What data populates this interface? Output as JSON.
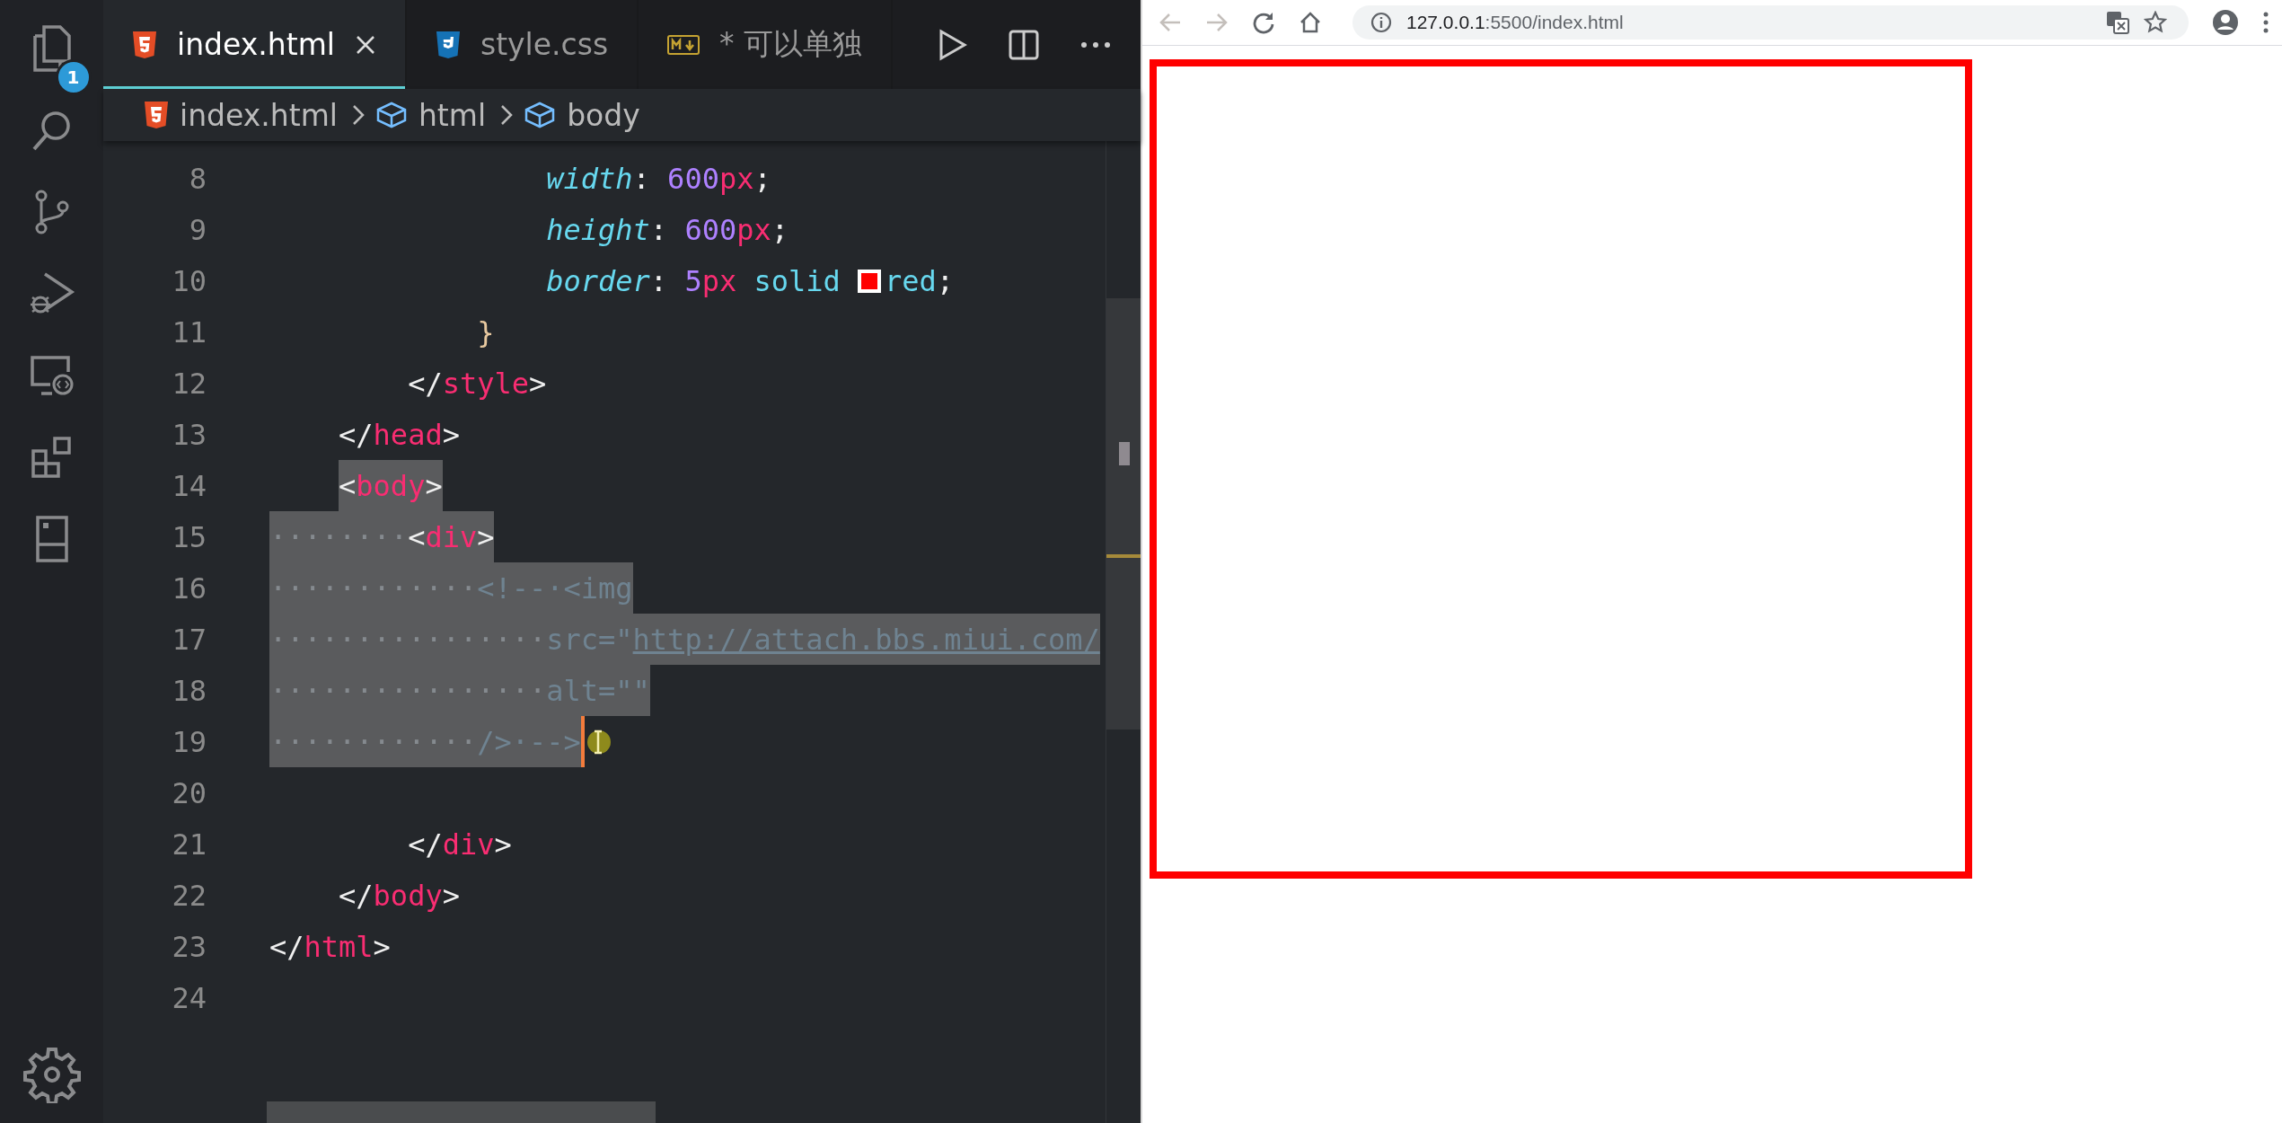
{
  "activity_bar": {
    "explorer_badge": "1"
  },
  "tabs": [
    {
      "label": "index.html",
      "kind": "html",
      "selected": true,
      "closable": true
    },
    {
      "label": "style.css",
      "kind": "css",
      "selected": false,
      "closable": false
    },
    {
      "label": "* 可以单独",
      "kind": "md",
      "selected": false,
      "closable": false
    }
  ],
  "breadcrumb": [
    {
      "label": "index.html",
      "kind": "html"
    },
    {
      "label": "html",
      "kind": "element"
    },
    {
      "label": "body",
      "kind": "element"
    }
  ],
  "code_lines": [
    {
      "number": "8",
      "selected": false,
      "segments": [
        {
          "text": "                width",
          "kind": "prop"
        },
        {
          "text": ": ",
          "kind": "punct"
        },
        {
          "text": "600",
          "kind": "num"
        },
        {
          "text": "px",
          "kind": "unit"
        },
        {
          "text": ";",
          "kind": "punct"
        }
      ]
    },
    {
      "number": "9",
      "selected": false,
      "segments": [
        {
          "text": "                height",
          "kind": "prop"
        },
        {
          "text": ": ",
          "kind": "punct"
        },
        {
          "text": "600",
          "kind": "num"
        },
        {
          "text": "px",
          "kind": "unit"
        },
        {
          "text": ";",
          "kind": "punct"
        }
      ]
    },
    {
      "number": "10",
      "selected": false,
      "segments": [
        {
          "text": "                border",
          "kind": "prop"
        },
        {
          "text": ": ",
          "kind": "punct"
        },
        {
          "text": "5",
          "kind": "num"
        },
        {
          "text": "px",
          "kind": "unit"
        },
        {
          "text": " solid ",
          "kind": "value"
        },
        {
          "kind": "swatch",
          "color": "#ff0000"
        },
        {
          "text": "red",
          "kind": "value"
        },
        {
          "text": ";",
          "kind": "punct"
        }
      ]
    },
    {
      "number": "11",
      "selected": false,
      "segments": [
        {
          "text": "            }",
          "kind": "brace"
        }
      ]
    },
    {
      "number": "12",
      "selected": false,
      "segments": [
        {
          "text": "        </",
          "kind": "punct"
        },
        {
          "text": "style",
          "kind": "tag"
        },
        {
          "text": ">",
          "kind": "punct"
        }
      ]
    },
    {
      "number": "13",
      "selected": false,
      "segments": [
        {
          "text": "    </",
          "kind": "punct"
        },
        {
          "text": "head",
          "kind": "tag"
        },
        {
          "text": ">",
          "kind": "punct"
        }
      ]
    },
    {
      "number": "14",
      "selected": true,
      "segments": [
        {
          "text": "    <",
          "kind": "punct"
        },
        {
          "text": "body",
          "kind": "tag"
        },
        {
          "text": ">",
          "kind": "punct"
        }
      ]
    },
    {
      "number": "15",
      "selected": true,
      "segments": [
        {
          "text": "········",
          "kind": "ws"
        },
        {
          "text": "<",
          "kind": "punct"
        },
        {
          "text": "div",
          "kind": "tag"
        },
        {
          "text": ">",
          "kind": "punct"
        }
      ]
    },
    {
      "number": "16",
      "selected": true,
      "segments": [
        {
          "text": "············",
          "kind": "ws"
        },
        {
          "text": "<!--·<img",
          "kind": "comment"
        }
      ]
    },
    {
      "number": "17",
      "selected": true,
      "segments": [
        {
          "text": "················",
          "kind": "ws"
        },
        {
          "text": "src=\"",
          "kind": "comment"
        },
        {
          "text": "http://attach.bbs.miui.com/",
          "kind": "link"
        }
      ]
    },
    {
      "number": "18",
      "selected": true,
      "segments": [
        {
          "text": "················",
          "kind": "ws"
        },
        {
          "text": "alt=\"\"",
          "kind": "comment"
        }
      ]
    },
    {
      "number": "19",
      "selected": true,
      "segments": [
        {
          "text": "············",
          "kind": "ws"
        },
        {
          "text": "/>·-->",
          "kind": "comment"
        }
      ]
    },
    {
      "number": "20",
      "selected": false
    },
    {
      "number": "21",
      "selected": false,
      "segments": [
        {
          "text": "        </",
          "kind": "punct"
        },
        {
          "text": "div",
          "kind": "tag"
        },
        {
          "text": ">",
          "kind": "punct"
        }
      ]
    },
    {
      "number": "22",
      "selected": false,
      "segments": [
        {
          "text": "    </",
          "kind": "punct"
        },
        {
          "text": "body",
          "kind": "tag"
        },
        {
          "text": ">",
          "kind": "punct"
        }
      ]
    },
    {
      "number": "23",
      "selected": false,
      "segments": [
        {
          "text": "</",
          "kind": "punct"
        },
        {
          "text": "html",
          "kind": "tag"
        },
        {
          "text": ">",
          "kind": "punct"
        }
      ]
    },
    {
      "number": "24",
      "selected": false
    }
  ],
  "browser": {
    "address_host": "127.0.0.1",
    "address_path": ":5500/index.html"
  }
}
